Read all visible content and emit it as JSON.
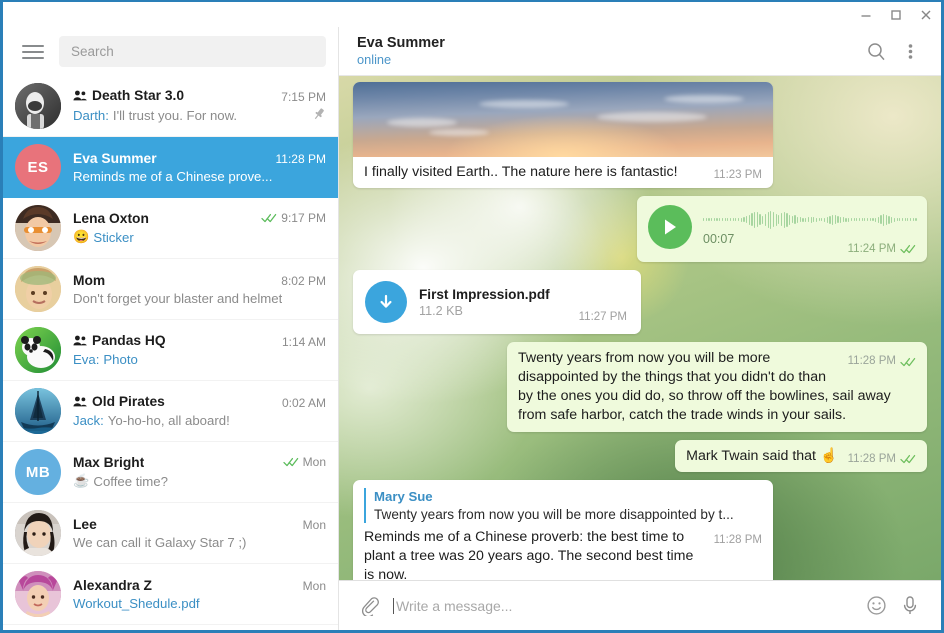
{
  "window": {
    "minimize_label": "Minimize",
    "maximize_label": "Maximize",
    "close_label": "Close"
  },
  "sidebar": {
    "menu_label": "Menu",
    "search": {
      "placeholder": "Search",
      "value": ""
    },
    "chats": [
      {
        "name": "Death Star 3.0",
        "is_group": true,
        "time": "7:15 PM",
        "sender": "Darth:",
        "preview": "I'll trust you. For now.",
        "preview_style": "plain",
        "pinned": true,
        "ticks": false,
        "selected": false,
        "avatar": {
          "type": "image",
          "kind": "stormtrooper",
          "initials": "",
          "color": "#5d5d5d"
        }
      },
      {
        "name": "Eva Summer",
        "is_group": false,
        "time": "11:28 PM",
        "sender": "",
        "preview": "Reminds me of a Chinese prove...",
        "preview_style": "plain",
        "pinned": false,
        "ticks": false,
        "selected": true,
        "avatar": {
          "type": "initials",
          "kind": "",
          "initials": "ES",
          "color": "#e8737b"
        }
      },
      {
        "name": "Lena Oxton",
        "is_group": false,
        "time": "9:17 PM",
        "sender": "",
        "preview": "Sticker",
        "preview_style": "accent",
        "preview_emoji": "😀",
        "pinned": false,
        "ticks": true,
        "selected": false,
        "avatar": {
          "type": "image",
          "kind": "tracer",
          "initials": "",
          "color": "#c88a6a"
        }
      },
      {
        "name": "Mom",
        "is_group": false,
        "time": "8:02 PM",
        "sender": "",
        "preview": "Don't forget your blaster and helmet",
        "preview_style": "plain",
        "pinned": false,
        "ticks": false,
        "selected": false,
        "avatar": {
          "type": "image",
          "kind": "mom",
          "initials": "",
          "color": "#d8b27a"
        }
      },
      {
        "name": "Pandas HQ",
        "is_group": true,
        "time": "1:14 AM",
        "sender": "Eva:",
        "preview": "Photo",
        "preview_style": "accent",
        "pinned": false,
        "ticks": false,
        "selected": false,
        "avatar": {
          "type": "image",
          "kind": "panda",
          "initials": "",
          "color": "#4caf50"
        }
      },
      {
        "name": "Old Pirates",
        "is_group": true,
        "time": "0:02 AM",
        "sender": "Jack:",
        "preview": "Yo-ho-ho, all aboard!",
        "preview_style": "plain",
        "pinned": false,
        "ticks": false,
        "selected": false,
        "avatar": {
          "type": "image",
          "kind": "ship",
          "initials": "",
          "color": "#2f6f9e"
        }
      },
      {
        "name": "Max Bright",
        "is_group": false,
        "time": "Mon",
        "sender": "",
        "preview": "Coffee time?",
        "preview_style": "plain",
        "preview_emoji": "☕",
        "pinned": false,
        "ticks": true,
        "selected": false,
        "avatar": {
          "type": "initials",
          "kind": "",
          "initials": "MB",
          "color": "#64b0e0"
        }
      },
      {
        "name": "Lee",
        "is_group": false,
        "time": "Mon",
        "sender": "",
        "preview": "We can call it Galaxy Star 7 ;)",
        "preview_style": "plain",
        "pinned": false,
        "ticks": false,
        "selected": false,
        "avatar": {
          "type": "image",
          "kind": "lee",
          "initials": "",
          "color": "#8a8a8a"
        }
      },
      {
        "name": "Alexandra Z",
        "is_group": false,
        "time": "Mon",
        "sender": "",
        "preview": "Workout_Shedule.pdf",
        "preview_style": "accent",
        "pinned": false,
        "ticks": false,
        "selected": false,
        "avatar": {
          "type": "image",
          "kind": "alexandra",
          "initials": "",
          "color": "#c86aa8"
        }
      }
    ]
  },
  "conversation": {
    "title": "Eva Summer",
    "status": "online",
    "search_label": "Search in conversation",
    "menu_label": "More options",
    "messages": [
      {
        "type": "photo",
        "direction": "in",
        "caption": "I finally visited Earth.. The nature here is fantastic!",
        "time": "11:23 PM",
        "ticks": false
      },
      {
        "type": "voice",
        "direction": "out",
        "duration": "00:07",
        "time": "11:24 PM",
        "ticks": true
      },
      {
        "type": "file",
        "direction": "in",
        "file_name": "First Impression.pdf",
        "file_size": "11.2 KB",
        "time": "11:27 PM",
        "ticks": false
      },
      {
        "type": "text",
        "direction": "out",
        "text": "Twenty years from now you will be more disappointed by the things that you didn't do than by the ones you did do, so throw off the bowlines, sail away from safe harbor, catch the trade winds in your sails.",
        "time": "11:28 PM",
        "ticks": true
      },
      {
        "type": "text",
        "direction": "out",
        "text": "Mark Twain said that ☝",
        "time": "11:28 PM",
        "ticks": true
      },
      {
        "type": "reply",
        "direction": "in",
        "reply_author": "Mary Sue",
        "reply_excerpt": "Twenty years from now you will be more disappointed by t...",
        "text": "Reminds me of a Chinese proverb: the best time to plant a tree was 20 years ago. The second best time is now.",
        "time": "11:28 PM",
        "ticks": false
      }
    ]
  },
  "composer": {
    "attach_label": "Attach file",
    "placeholder": "Write a message...",
    "value": "",
    "emoji_label": "Emoji",
    "mic_label": "Record voice message"
  },
  "colors": {
    "accent": "#3ba5dd",
    "selected_row": "#3ba5dd",
    "out_bubble": "#effadc",
    "in_bubble": "#ffffff",
    "tick_green": "#5cbc5c",
    "link_blue": "#3b8fc4"
  }
}
